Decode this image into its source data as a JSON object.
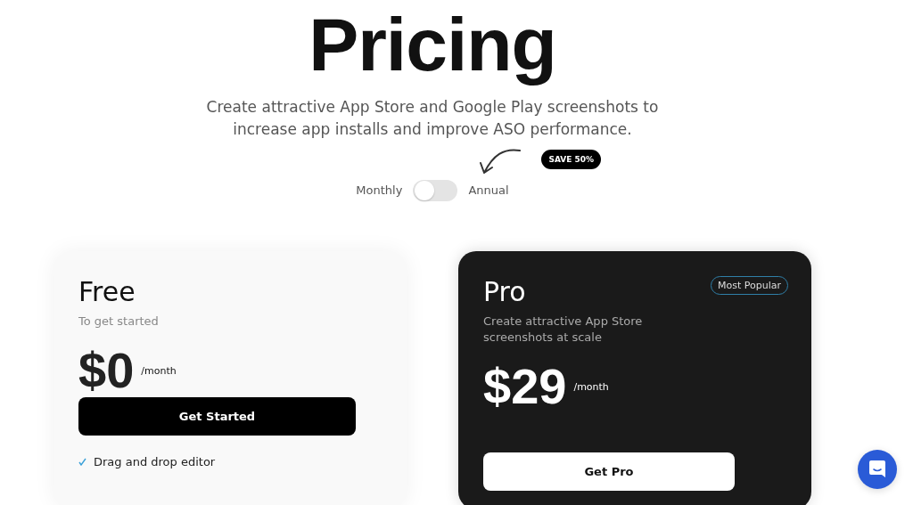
{
  "header": {
    "title": "Pricing",
    "subtitle": "Create attractive App Store and Google Play screenshots to increase app installs and improve ASO performance."
  },
  "billing": {
    "left_label": "Monthly",
    "right_label": "Annual",
    "annual": false,
    "badge": "SAVE 50%"
  },
  "plans": [
    {
      "kind": "light",
      "name": "Free",
      "description": "To get started",
      "price": "$0",
      "period": "/month",
      "button": "Get Started",
      "features": [
        "Drag and drop editor"
      ]
    },
    {
      "kind": "dark",
      "name": "Pro",
      "tag": "Most Popular",
      "description": "Create attractive App Store screenshots at scale",
      "price": "$29",
      "period": "/month",
      "button": "Get Pro"
    }
  ]
}
